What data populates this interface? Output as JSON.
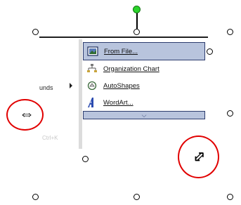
{
  "menu": {
    "items": [
      {
        "label": "From File...",
        "icon": "picture-icon",
        "highlighted": true
      },
      {
        "label": "Organization Chart",
        "icon": "org-chart-icon",
        "highlighted": false
      },
      {
        "label": "AutoShapes",
        "icon": "autoshapes-icon",
        "highlighted": false
      },
      {
        "label": "WordArt...",
        "icon": "wordart-icon",
        "highlighted": false
      }
    ],
    "expand_glyph": "⌵"
  },
  "fragments": {
    "left_label": "unds",
    "shortcut": "Ctrl+K"
  },
  "cursors": {
    "horizontal_resize": "⇔",
    "diagonal_resize": "⇕"
  },
  "colors": {
    "menu_highlight": "#b8c4dd",
    "menu_border": "#2d3d6e",
    "annotation_red": "#e10000",
    "rotation_handle": "#2bd32b"
  }
}
